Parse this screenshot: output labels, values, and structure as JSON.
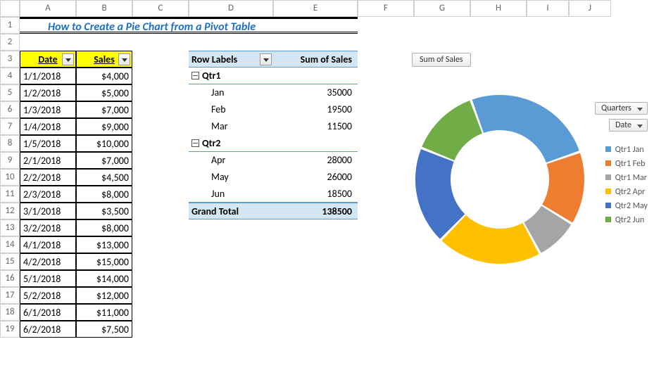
{
  "title": "How to Create a Pie Chart from a Pivot Table",
  "columns": [
    "A",
    "B",
    "C",
    "D",
    "E",
    "F",
    "G",
    "H",
    "I",
    "J"
  ],
  "rows": [
    1,
    2,
    3,
    4,
    5,
    6,
    7,
    8,
    9,
    10,
    11,
    12,
    13,
    14,
    15,
    16,
    17,
    18,
    19
  ],
  "table": {
    "headers": {
      "date": "Date",
      "sales": "Sales"
    },
    "rows": [
      {
        "date": "1/1/2018",
        "sales": "$4,000"
      },
      {
        "date": "1/2/2018",
        "sales": "$5,000"
      },
      {
        "date": "1/3/2018",
        "sales": "$7,000"
      },
      {
        "date": "1/4/2018",
        "sales": "$9,000"
      },
      {
        "date": "1/5/2018",
        "sales": "$10,000"
      },
      {
        "date": "2/1/2018",
        "sales": "$7,000"
      },
      {
        "date": "2/2/2018",
        "sales": "$4,500"
      },
      {
        "date": "2/3/2018",
        "sales": "$8,000"
      },
      {
        "date": "3/1/2018",
        "sales": "$3,500"
      },
      {
        "date": "3/2/2018",
        "sales": "$8,000"
      },
      {
        "date": "4/1/2018",
        "sales": "$13,000"
      },
      {
        "date": "4/2/2018",
        "sales": "$15,000"
      },
      {
        "date": "5/1/2018",
        "sales": "$14,000"
      },
      {
        "date": "5/2/2018",
        "sales": "$12,000"
      },
      {
        "date": "6/1/2018",
        "sales": "$11,000"
      },
      {
        "date": "6/2/2018",
        "sales": "$7,500"
      }
    ]
  },
  "pivot": {
    "rowLabelsHeader": "Row Labels",
    "valuesHeader": "Sum of Sales",
    "qtr1": "Qtr1",
    "jan": {
      "label": "Jan",
      "value": "35000"
    },
    "feb": {
      "label": "Feb",
      "value": "19500"
    },
    "mar": {
      "label": "Mar",
      "value": "11500"
    },
    "qtr2": "Qtr2",
    "apr": {
      "label": "Apr",
      "value": "28000"
    },
    "may": {
      "label": "May",
      "value": "26000"
    },
    "jun": {
      "label": "Jun",
      "value": "18500"
    },
    "grandTotal": {
      "label": "Grand Total",
      "value": "138500"
    }
  },
  "chart": {
    "titleBtn": "Sum of Sales",
    "slicer1": "Quarters",
    "slicer2": "Date",
    "legend": [
      {
        "label": "Qtr1 Jan",
        "color": "#5b9bd5"
      },
      {
        "label": "Qtr1 Feb",
        "color": "#ed7d31"
      },
      {
        "label": "Qtr1 Mar",
        "color": "#a5a5a5"
      },
      {
        "label": "Qtr2 Apr",
        "color": "#ffc000"
      },
      {
        "label": "Qtr2 May",
        "color": "#4472c4"
      },
      {
        "label": "Qtr2 Jun",
        "color": "#70ad47"
      }
    ]
  },
  "chart_data": {
    "type": "pie",
    "title": "Sum of Sales",
    "series": [
      {
        "name": "Qtr1 Jan",
        "value": 35000,
        "color": "#5b9bd5"
      },
      {
        "name": "Qtr1 Feb",
        "value": 19500,
        "color": "#ed7d31"
      },
      {
        "name": "Qtr1 Mar",
        "value": 11500,
        "color": "#a5a5a5"
      },
      {
        "name": "Qtr2 Apr",
        "value": 28000,
        "color": "#ffc000"
      },
      {
        "name": "Qtr2 May",
        "value": 26000,
        "color": "#4472c4"
      },
      {
        "name": "Qtr2 Jun",
        "value": 18500,
        "color": "#70ad47"
      }
    ],
    "total": 138500
  }
}
